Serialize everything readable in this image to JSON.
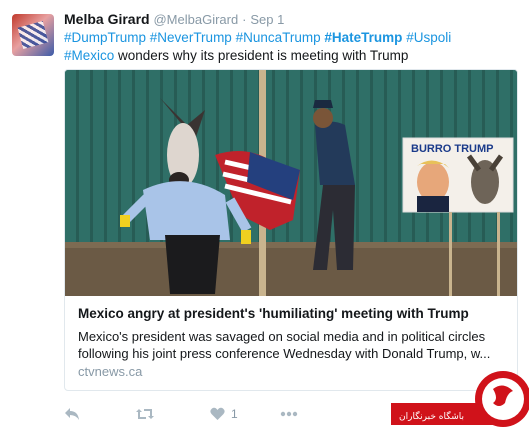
{
  "tweet": {
    "author_name": "Melba Girard",
    "author_handle": "@MelbaGirard",
    "separator": "·",
    "timestamp": "Sep 1",
    "hashtags_line": [
      "#DumpTrump",
      "#NeverTrump",
      "#NuncaTrump",
      "#HateTrump",
      "#Uspoli"
    ],
    "line2_tag": "#Mexico",
    "line2_text": " wonders why its president is meeting with Trump"
  },
  "card": {
    "title": "Mexico angry at president's 'humiliating' meeting with Trump",
    "description": "Mexico's president was savaged on social media and in political circles following his joint press conference Wednesday with Donald Trump, w...",
    "domain": "ctvnews.ca",
    "photo_sign_text": "BURRO TRUMP"
  },
  "actions": {
    "reply_icon": "reply-icon",
    "retweet_icon": "retweet-icon",
    "like_icon": "heart-icon",
    "like_count": "1",
    "more_icon": "more-icon"
  },
  "watermark": {
    "text": "باشگاه خبرنگاران"
  },
  "colors": {
    "link": "#1b95e0",
    "muted": "#8899a6",
    "watermark_red": "#d0121a"
  }
}
